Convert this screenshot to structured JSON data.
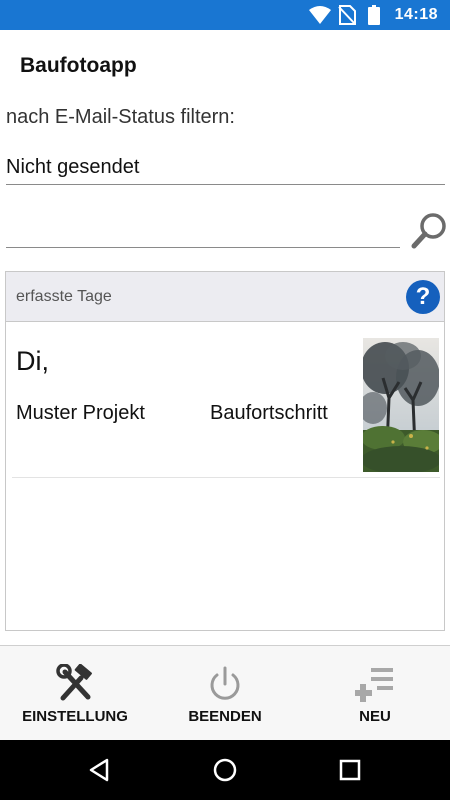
{
  "status_bar": {
    "time": "14:18",
    "icons": [
      "wifi-icon",
      "no-sim-icon",
      "battery-icon"
    ]
  },
  "app": {
    "title": "Baufotoapp"
  },
  "filter": {
    "label": "nach E-Mail-Status filtern:",
    "selected": "Nicht gesendet"
  },
  "search": {
    "value": "",
    "placeholder": "",
    "icon": "search-icon"
  },
  "list": {
    "header": "erfasste Tage",
    "help_label": "?",
    "entries": [
      {
        "day": "Di,",
        "project": "Muster Projekt",
        "category": "Baufortschritt",
        "thumbnail": "tree-photo"
      }
    ]
  },
  "bottom_nav": {
    "settings_label": "EINSTELLUNG",
    "quit_label": "BEENDEN",
    "new_label": "NEU",
    "icons": [
      "tools-icon",
      "power-icon",
      "add-list-icon"
    ]
  },
  "system_nav": {
    "icons": [
      "back-icon",
      "home-icon",
      "recents-icon"
    ]
  },
  "colors": {
    "status_bar": "#1976d2",
    "help_button": "#1560bd",
    "header_bg": "#ececf1",
    "nav_bar": "#000000"
  }
}
